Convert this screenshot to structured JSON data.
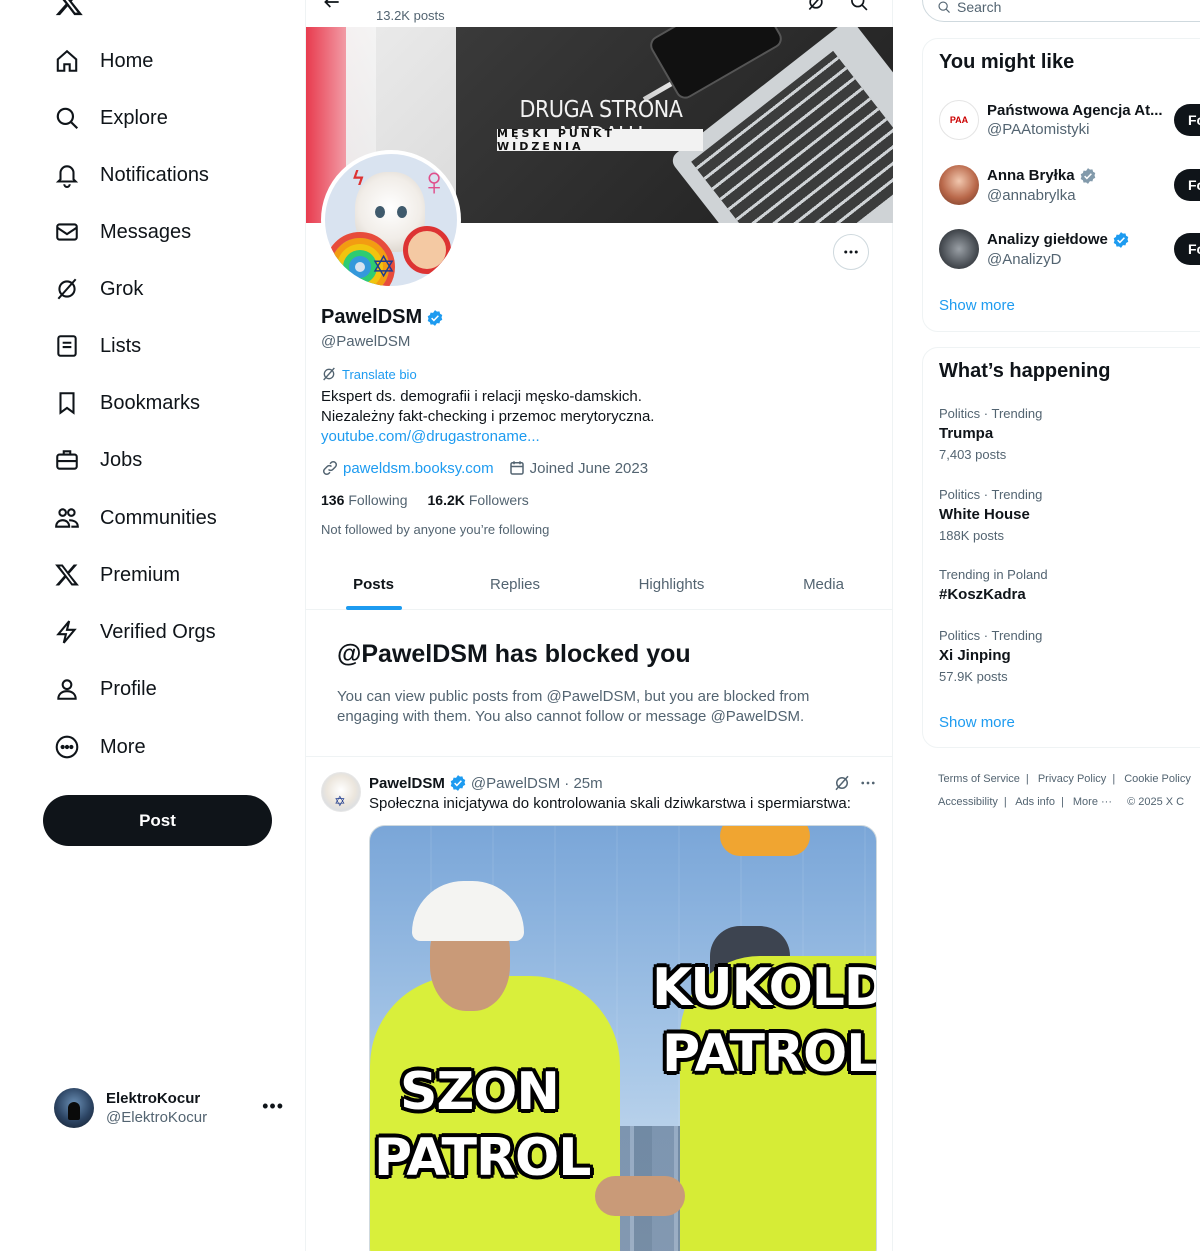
{
  "nav": {
    "items": [
      {
        "label": "Home",
        "icon": "home-icon"
      },
      {
        "label": "Explore",
        "icon": "search-icon"
      },
      {
        "label": "Notifications",
        "icon": "bell-icon"
      },
      {
        "label": "Messages",
        "icon": "envelope-icon"
      },
      {
        "label": "Grok",
        "icon": "grok-icon"
      },
      {
        "label": "Lists",
        "icon": "list-icon"
      },
      {
        "label": "Bookmarks",
        "icon": "bookmark-icon"
      },
      {
        "label": "Jobs",
        "icon": "briefcase-icon"
      },
      {
        "label": "Communities",
        "icon": "people-icon"
      },
      {
        "label": "Premium",
        "icon": "x-logo-icon"
      },
      {
        "label": "Verified Orgs",
        "icon": "lightning-icon"
      },
      {
        "label": "Profile",
        "icon": "person-icon"
      },
      {
        "label": "More",
        "icon": "more-circle-icon"
      }
    ],
    "post_button": "Post",
    "account": {
      "name": "ElektroKocur",
      "handle": "@ElektroKocur"
    }
  },
  "profile": {
    "post_count": "13.2K posts",
    "banner_title": "DRUGA STRONA MEDALU",
    "banner_subtitle": "MĘSKI PUNKT WIDZENIA",
    "name": "PawelDSM",
    "handle": "@PawelDSM",
    "translate": "Translate bio",
    "bio_line1": "Ekspert ds. demografii i relacji męsko-damskich.",
    "bio_line2": "Niezależny fakt-checking i przemoc merytoryczna.",
    "bio_link": "youtube.com/@drugastroname...",
    "website": "paweldsm.booksy.com",
    "joined": "Joined June 2023",
    "following_count": "136",
    "following_label": "Following",
    "followers_count": "16.2K",
    "followers_label": "Followers",
    "not_followed": "Not followed by anyone you’re following"
  },
  "tabs": [
    "Posts",
    "Replies",
    "Highlights",
    "Media"
  ],
  "blocked": {
    "title": "@PawelDSM has blocked you",
    "message": "You can view public posts from @PawelDSM, but you are blocked from engaging with them. You also cannot follow or message @PawelDSM."
  },
  "tweet": {
    "name": "PawelDSM",
    "handle": "@PawelDSM",
    "time": "· 25m",
    "text": "Społeczna inicjatywa do kontrolowania skali dziwkarstwa i spermiarstwa:",
    "meme_top_1": "KUKOLD",
    "meme_top_2": "PATROL",
    "meme_bottom_1": "SZON",
    "meme_bottom_2": "PATROL"
  },
  "right": {
    "search_placeholder": "Search",
    "you_might_like": "You might like",
    "suggestions": [
      {
        "name": "Państwowa Agencja At...",
        "handle": "@PAAtomistyki",
        "follow": "Fo",
        "badge": false
      },
      {
        "name": "Anna Bryłka",
        "handle": "@annabrylka",
        "follow": "Fo",
        "badge": "grey"
      },
      {
        "name": "Analizy giełdowe",
        "handle": "@AnalizyD",
        "follow": "Fo",
        "badge": "blue"
      }
    ],
    "show_more": "Show more",
    "whats_happening": "What’s happening",
    "trends": [
      {
        "context": "Politics · Trending",
        "title": "Trumpa",
        "count": "7,403 posts"
      },
      {
        "context": "Politics · Trending",
        "title": "White House",
        "count": "188K posts"
      },
      {
        "context": "Trending in Poland",
        "title": "#KoszKadra",
        "count": ""
      },
      {
        "context": "Politics · Trending",
        "title": "Xi Jinping",
        "count": "57.9K posts"
      }
    ],
    "footer": {
      "terms": "Terms of Service",
      "privacy": "Privacy Policy",
      "cookie": "Cookie Policy",
      "accessibility": "Accessibility",
      "ads": "Ads info",
      "more": "More ···",
      "copyright": "© 2025 X C"
    }
  },
  "colors": {
    "accent": "#1d9bf0",
    "text": "#0f1419",
    "muted": "#536471",
    "border": "#eff3f4"
  }
}
